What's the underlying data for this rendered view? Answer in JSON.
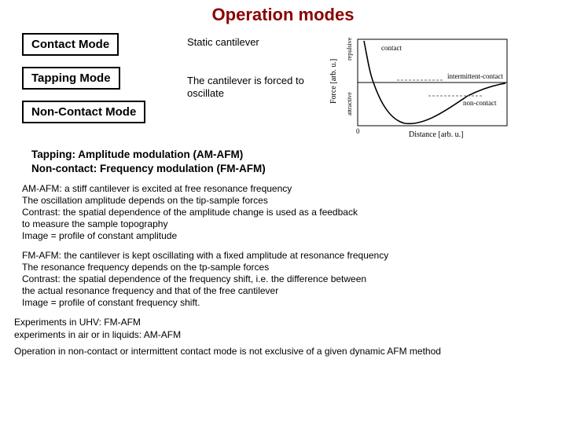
{
  "title": "Operation modes",
  "modes": {
    "contact": "Contact Mode",
    "tapping": "Tapping Mode",
    "noncontact": "Non-Contact Mode"
  },
  "descriptions": {
    "static": "Static cantilever",
    "oscillate": "The cantilever is forced to oscillate"
  },
  "subhead": {
    "line1": "Tapping: Amplitude modulation (AM-AFM)",
    "line2": "Non-contact: Frequency modulation (FM-AFM)"
  },
  "am_afm": "AM-AFM: a stiff cantilever is excited at free resonance frequency\nThe oscillation amplitude depends on the tip-sample forces\nContrast: the spatial dependence of the amplitude change is used as a feedback\n            to measure the sample topography\nImage = profile of constant amplitude",
  "fm_afm": "FM-AFM: the cantilever is kept oscillating with a fixed amplitude at resonance frequency\nThe resonance frequency depends on the tp-sample forces\nContrast: the spatial dependence of the frequency shift, i.e. the difference between\n               the actual resonance frequency and that of the free cantilever\nImage = profile of constant frequency shift.",
  "footer": {
    "exp1": "Experiments in UHV: FM-AFM",
    "exp2": "experiments in air or in liquids: AM-AFM",
    "note": "Operation in non-contact or intermittent contact mode is not exclusive of a given dynamic AFM method"
  },
  "chart_data": {
    "type": "line",
    "title": "",
    "xlabel": "Distance [arb. u.]",
    "ylabel": "Force [arb. u.]",
    "y_upper_label": "repulsive",
    "y_lower_label": "attractive",
    "annotations": [
      "contact",
      "intermittent-contact",
      "non-contact"
    ],
    "x": [
      0.02,
      0.05,
      0.08,
      0.1,
      0.12,
      0.15,
      0.18,
      0.22,
      0.28,
      0.35,
      0.45,
      0.6,
      0.8,
      1.0
    ],
    "y": [
      1.0,
      0.7,
      0.4,
      0.1,
      -0.2,
      -0.55,
      -0.8,
      -0.95,
      -1.0,
      -0.9,
      -0.7,
      -0.45,
      -0.2,
      -0.05
    ],
    "xlim": [
      0,
      1
    ],
    "ylim": [
      -1.05,
      1.05
    ]
  }
}
